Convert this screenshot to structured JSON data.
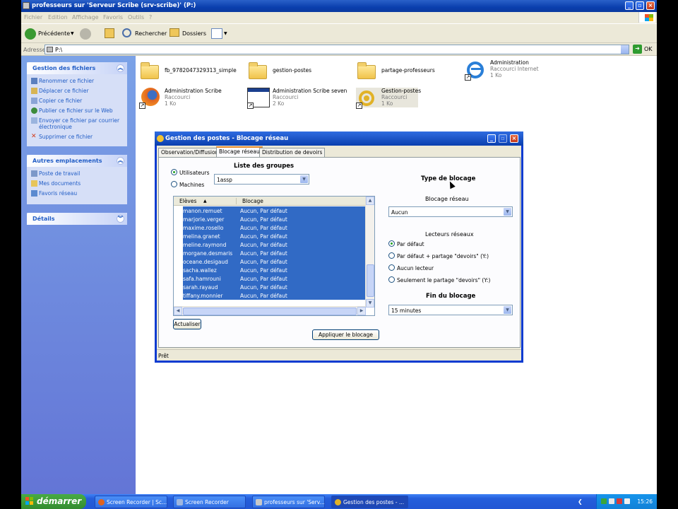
{
  "window": {
    "title": "professeurs sur 'Serveur Scribe (srv-scribe)' (P:)",
    "menu": [
      "Fichier",
      "Edition",
      "Affichage",
      "Favoris",
      "Outils",
      "?"
    ]
  },
  "toolbar": {
    "back_label": "Précédente",
    "search_label": "Rechercher",
    "folders_label": "Dossiers"
  },
  "address": {
    "label": "Adresse",
    "value": "P:\\",
    "go_label": "OK"
  },
  "leftpane": {
    "file_tasks": {
      "title": "Gestion des fichiers",
      "items": [
        "Renommer ce fichier",
        "Déplacer ce fichier",
        "Copier ce fichier",
        "Publier ce fichier sur le Web",
        "Envoyer ce fichier par courrier électronique",
        "Supprimer ce fichier"
      ]
    },
    "other_places": {
      "title": "Autres emplacements",
      "items": [
        "Poste de travail",
        "Mes documents",
        "Favoris réseau"
      ]
    },
    "details": {
      "title": "Détails"
    }
  },
  "files": [
    {
      "name": "fb_9782047329313_simple",
      "line2": "",
      "line3": "",
      "icon": "folder-icon"
    },
    {
      "name": "gestion-postes",
      "line2": "",
      "line3": "",
      "icon": "folder-icon"
    },
    {
      "name": "partage-professeurs",
      "line2": "",
      "line3": "",
      "icon": "folder-icon"
    },
    {
      "name": "Administration",
      "line2": "Raccourci Internet",
      "line3": "1 Ko",
      "icon": "internet-explorer-icon"
    },
    {
      "name": "Administration Scribe",
      "line2": "Raccourci",
      "line3": "1 Ko",
      "icon": "firefox-icon"
    },
    {
      "name": "Administration Scribe seven",
      "line2": "Raccourci",
      "line3": "2 Ko",
      "icon": "application-window-icon"
    },
    {
      "name": "Gestion-postes",
      "line2": "Raccourci",
      "line3": "1 Ko",
      "icon": "gestion-postes-icon"
    }
  ],
  "dialog": {
    "title": "Gestion des postes - Blocage réseau",
    "tabs": [
      "Observation/Diffusion",
      "Blocage réseau",
      "Distribution de devoirs"
    ],
    "groups_title": "Liste des groupes",
    "radio_users": "Utilisateurs",
    "radio_machines": "Machines",
    "group_selected": "1assp",
    "list_headers": {
      "students": "Elèves",
      "blocking": "Blocage"
    },
    "rows": [
      {
        "student": "manon.remuet",
        "blocking": "Aucun, Par défaut"
      },
      {
        "student": "marjorie.verger",
        "blocking": "Aucun, Par défaut"
      },
      {
        "student": "maxime.rosello",
        "blocking": "Aucun, Par défaut"
      },
      {
        "student": "melina.granet",
        "blocking": "Aucun, Par défaut"
      },
      {
        "student": "meline.raymond",
        "blocking": "Aucun, Par défaut"
      },
      {
        "student": "morgane.desmaris",
        "blocking": "Aucun, Par défaut"
      },
      {
        "student": "oceane.desigaud",
        "blocking": "Aucun, Par défaut"
      },
      {
        "student": "sacha.wallez",
        "blocking": "Aucun, Par défaut"
      },
      {
        "student": "safa.hamrouni",
        "blocking": "Aucun, Par défaut"
      },
      {
        "student": "sarah.rayaud",
        "blocking": "Aucun, Par défaut"
      },
      {
        "student": "tiffany.monnier",
        "blocking": "Aucun, Par défaut"
      }
    ],
    "refresh_label": "Actualiser",
    "apply_label": "Appliquer le blocage",
    "block_type_title": "Type de blocage",
    "network_block_label": "Blocage réseau",
    "network_block_value": "Aucun",
    "network_drives_label": "Lecteurs réseaux",
    "drive_options": [
      "Par défaut",
      "Par défaut + partage \"devoirs\" (Y:)",
      "Aucun lecteur",
      "Seulement le partage \"devoirs\" (Y:)"
    ],
    "end_title": "Fin du blocage",
    "end_value": "15 minutes",
    "status": "Prêt"
  },
  "taskbar": {
    "start_label": "démarrer",
    "items": [
      "Screen Recorder | Sc...",
      "Screen Recorder",
      "professeurs sur 'Serv...",
      "Gestion des postes - ..."
    ],
    "clock": "15:26"
  },
  "colors": {
    "selection": "#316ac5",
    "xp_blue": "#0a3fae",
    "taskbar": "#245edb"
  }
}
